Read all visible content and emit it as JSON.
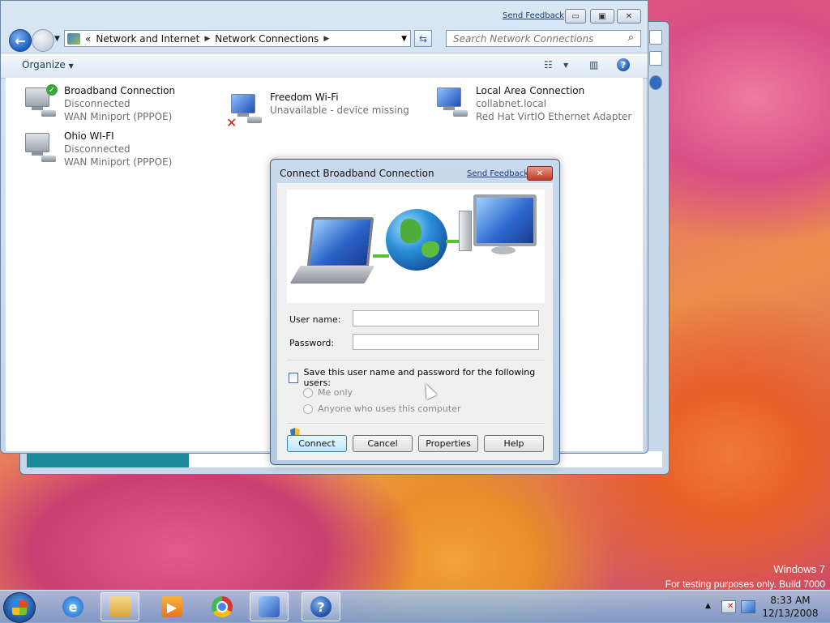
{
  "explorer": {
    "send_feedback": "Send Feedback",
    "breadcrumb": {
      "overflow": "«",
      "items": [
        "Network and Internet",
        "Network Connections"
      ]
    },
    "search_placeholder": "Search Network Connections",
    "toolbar": {
      "organize": "Organize"
    },
    "connections": [
      {
        "name": "Broadband Connection",
        "status": "Disconnected",
        "device": "WAN Miniport (PPPOE)",
        "state": "connected-check"
      },
      {
        "name": "Freedom Wi-Fi",
        "status": "Unavailable - device missing",
        "device": "",
        "state": "missing"
      },
      {
        "name": "Local Area Connection",
        "status": "collabnet.local",
        "device": "Red Hat VirtIO Ethernet Adapter",
        "state": "normal"
      },
      {
        "name": "Ohio WI-FI",
        "status": "Disconnected",
        "device": "WAN Miniport (PPPOE)",
        "state": "normal"
      }
    ]
  },
  "dialog": {
    "title": "Connect Broadband Connection",
    "send_feedback": "Send Feedback",
    "close_icon": "close-icon",
    "username_label": "User name:",
    "username_value": "",
    "password_label": "Password:",
    "password_value": "",
    "save_label": "Save this user name and password for the following users:",
    "save_checked": false,
    "radio_me_only": "Me only",
    "radio_anyone": "Anyone who uses this computer",
    "buttons": {
      "connect": "Connect",
      "cancel": "Cancel",
      "properties": "Properties",
      "help": "Help"
    }
  },
  "watermark": {
    "line1": "Windows 7",
    "line2": "For testing purposes only. Build 7000"
  },
  "taskbar": {
    "apps": [
      "windows-explorer",
      "internet-explorer",
      "media-player",
      "chrome",
      "network-connections",
      "help-and-support"
    ],
    "time": "8:33 AM",
    "date": "12/13/2008"
  },
  "colors": {
    "dialog_bg": "#f0f0f0",
    "title_blue": "#1a3b7a",
    "close_red": "#c23a22"
  }
}
